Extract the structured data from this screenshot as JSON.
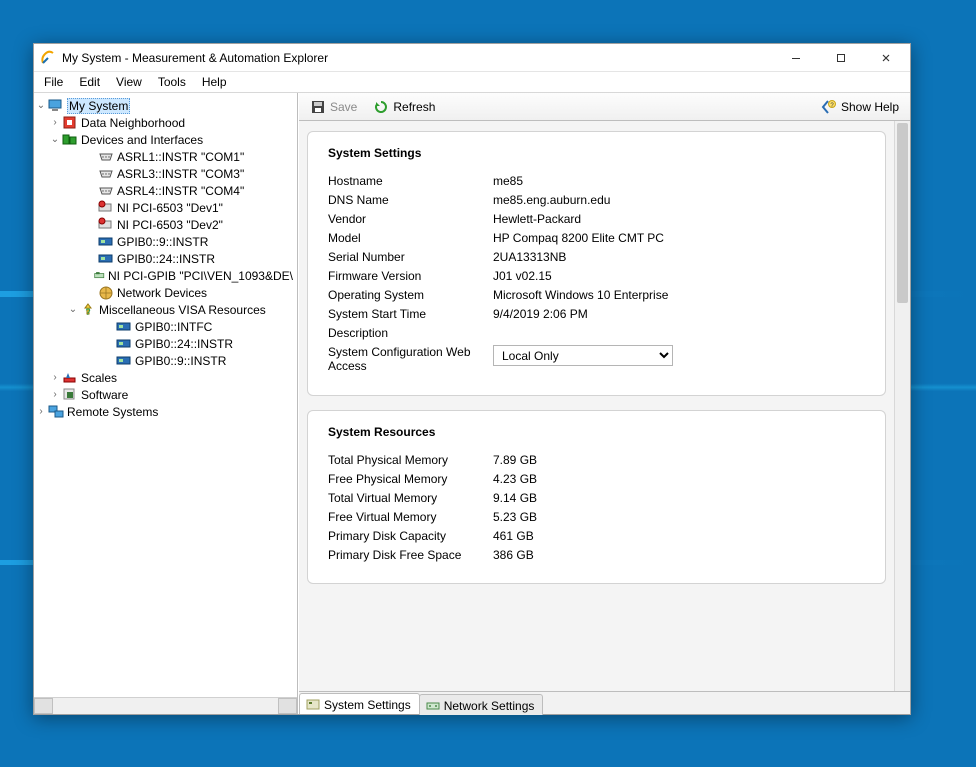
{
  "window": {
    "title": "My System - Measurement & Automation Explorer"
  },
  "menu": {
    "file": "File",
    "edit": "Edit",
    "view": "View",
    "tools": "Tools",
    "help": "Help"
  },
  "tree": {
    "root": "My System",
    "data_neighborhood": "Data Neighborhood",
    "devices_and_interfaces": "Devices and Interfaces",
    "items": {
      "asrl1": "ASRL1::INSTR \"COM1\"",
      "asrl3": "ASRL3::INSTR \"COM3\"",
      "asrl4": "ASRL4::INSTR \"COM4\"",
      "pci1": "NI PCI-6503 \"Dev1\"",
      "pci2": "NI PCI-6503 \"Dev2\"",
      "gpib9": "GPIB0::9::INSTR",
      "gpib24": "GPIB0::24::INSTR",
      "pcigpib": "NI PCI-GPIB \"PCI\\VEN_1093&DE\\",
      "network_devices": "Network Devices"
    },
    "misc_visa": "Miscellaneous VISA Resources",
    "misc": {
      "intfc": "GPIB0::INTFC",
      "g24": "GPIB0::24::INSTR",
      "g9": "GPIB0::9::INSTR"
    },
    "scales": "Scales",
    "software": "Software",
    "remote_systems": "Remote Systems"
  },
  "toolbar": {
    "save": "Save",
    "refresh": "Refresh",
    "show_help": "Show Help"
  },
  "settings_panel": {
    "title": "System Settings",
    "hostname_k": "Hostname",
    "hostname_v": "me85",
    "dns_k": "DNS Name",
    "dns_v": "me85.eng.auburn.edu",
    "vendor_k": "Vendor",
    "vendor_v": "Hewlett-Packard",
    "model_k": "Model",
    "model_v": "HP Compaq 8200 Elite CMT PC",
    "serial_k": "Serial Number",
    "serial_v": "2UA13313NB",
    "fw_k": "Firmware Version",
    "fw_v": "J01 v02.15",
    "os_k": "Operating System",
    "os_v": "Microsoft Windows 10 Enterprise",
    "start_k": "System Start Time",
    "start_v": "9/4/2019 2:06 PM",
    "desc_k": "Description",
    "webaccess_k": "System Configuration Web Access",
    "webaccess_sel": "Local Only"
  },
  "resources_panel": {
    "title": "System Resources",
    "tpm_k": "Total Physical Memory",
    "tpm_v": "7.89 GB",
    "fpm_k": "Free Physical Memory",
    "fpm_v": "4.23 GB",
    "tvm_k": "Total Virtual Memory",
    "tvm_v": "9.14 GB",
    "fvm_k": "Free Virtual Memory",
    "fvm_v": "5.23 GB",
    "pdc_k": "Primary Disk Capacity",
    "pdc_v": "461 GB",
    "pdf_k": "Primary Disk Free Space",
    "pdf_v": "386 GB"
  },
  "bottom_tabs": {
    "system_settings": "System Settings",
    "network_settings": "Network Settings"
  }
}
